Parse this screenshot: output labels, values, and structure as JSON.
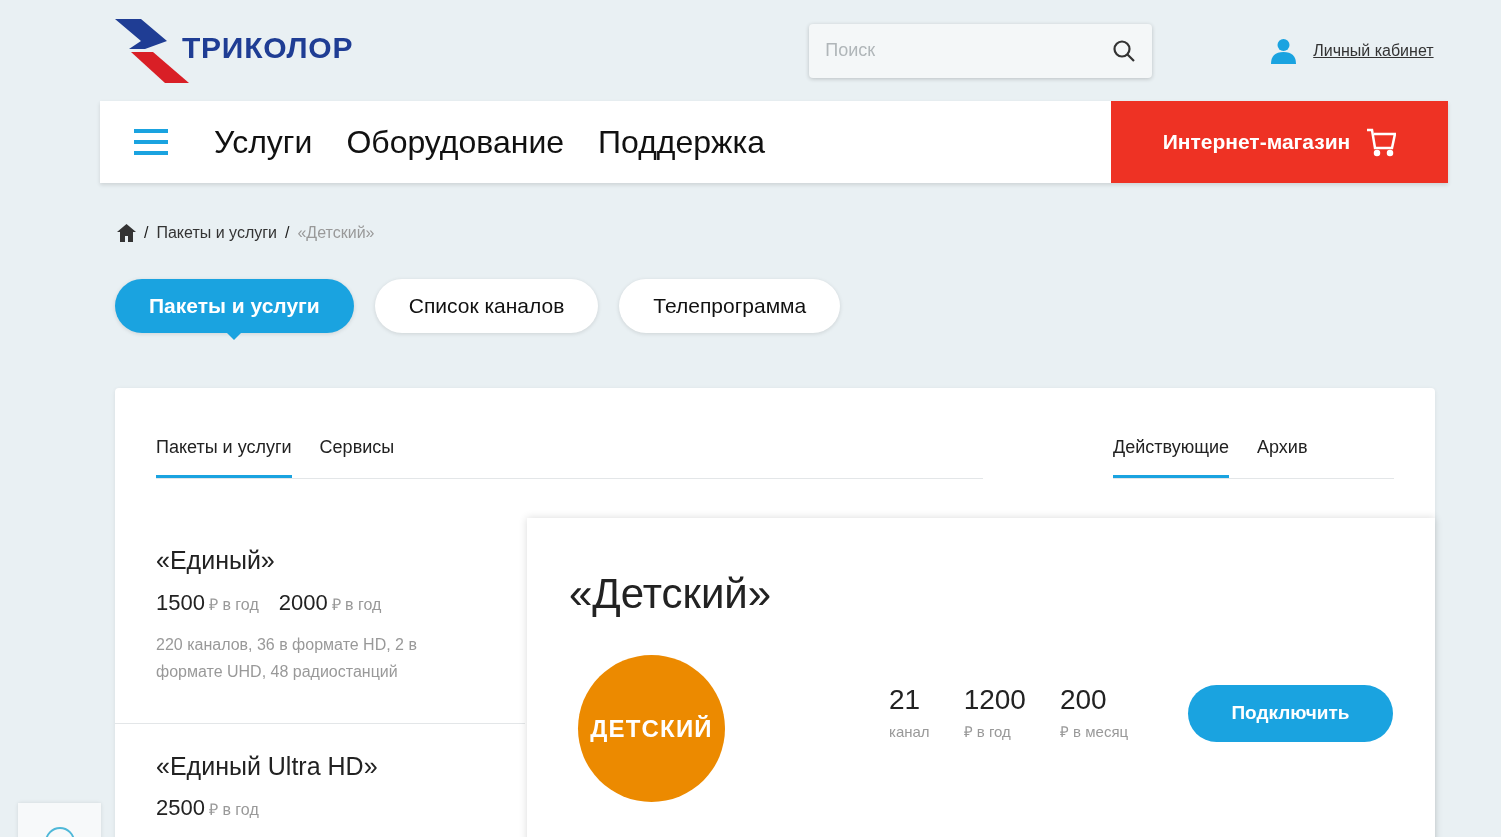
{
  "logo": {
    "text": "ТРИКОЛОР"
  },
  "search": {
    "placeholder": "Поиск"
  },
  "account_link": "Личный кабинет",
  "nav": {
    "items": [
      "Услуги",
      "Оборудование",
      "Поддержка"
    ],
    "shop_button": "Интернет-магазин"
  },
  "breadcrumb": [
    {
      "kind": "home"
    },
    {
      "kind": "separator",
      "text": "/"
    },
    {
      "kind": "link",
      "text": "Пакеты и услуги"
    },
    {
      "kind": "separator",
      "text": "/"
    },
    {
      "kind": "current",
      "text": "«Детский»"
    }
  ],
  "section_tabs": [
    {
      "label": "Пакеты и услуги",
      "selected": true
    },
    {
      "label": "Список каналов",
      "selected": false
    },
    {
      "label": "Телепрограмма",
      "selected": false
    }
  ],
  "card": {
    "tabs": [
      {
        "label": "Пакеты и услуги",
        "selected": true
      },
      {
        "label": "Сервисы",
        "selected": false
      }
    ],
    "filter_tabs": [
      {
        "label": "Действующие",
        "selected": true
      },
      {
        "label": "Архив",
        "selected": false
      }
    ],
    "packages": [
      {
        "name": "«Единый»",
        "prices": [
          {
            "amount": "1500",
            "unit": "₽ в год"
          },
          {
            "amount": "2000",
            "unit": "₽ в год"
          }
        ],
        "description": "220 каналов, 36 в формате HD, 2 в формате UHD, 48 радиостанций"
      },
      {
        "name": "«Единый Ultra HD»",
        "prices": [
          {
            "amount": "2500",
            "unit": "₽ в год"
          }
        ]
      }
    ],
    "detail": {
      "title": "«Детский»",
      "badge": "ДЕТСКИЙ",
      "stats": [
        {
          "value": "21",
          "label": "канал"
        },
        {
          "value": "1200",
          "label": "₽ в год"
        },
        {
          "value": "200",
          "label": "₽ в месяц"
        }
      ],
      "button": "Подключить"
    }
  }
}
